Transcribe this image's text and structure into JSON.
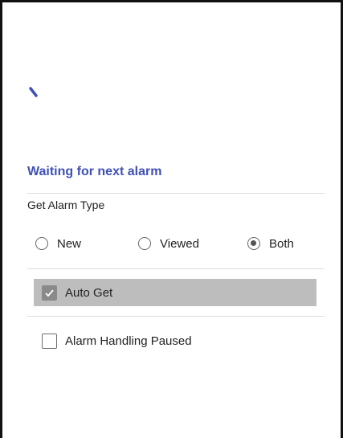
{
  "status": {
    "title": "Waiting for next alarm",
    "spinner_color": "#3f51b5"
  },
  "get_alarm_type": {
    "label": "Get Alarm Type",
    "options": [
      {
        "label": "New",
        "selected": false
      },
      {
        "label": "Viewed",
        "selected": false
      },
      {
        "label": "Both",
        "selected": true
      }
    ]
  },
  "auto_get": {
    "label": "Auto Get",
    "checked": true
  },
  "alarm_handling_paused": {
    "label": "Alarm Handling Paused",
    "checked": false
  },
  "colors": {
    "accent": "#3f51b5",
    "highlight_row": "#bdbdbd",
    "divider": "#dcdcdc"
  }
}
